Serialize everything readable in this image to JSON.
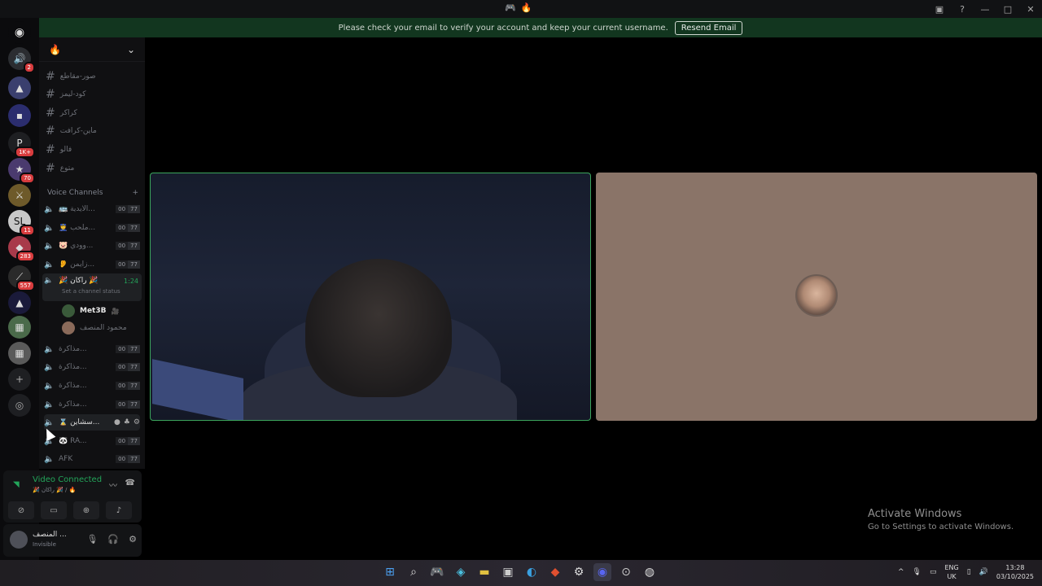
{
  "window": {
    "title_icons": [
      "game-icon",
      "fire-icon"
    ],
    "controls": [
      "inbox-icon",
      "help-icon",
      "minimize",
      "maximize",
      "close"
    ]
  },
  "banner": {
    "message": "Please check your email to verify your account and keep your current username.",
    "resend_label": "Resend Email"
  },
  "servers": [
    {
      "name": "dm",
      "badge": "2"
    },
    {
      "name": "server-a",
      "badge": ""
    },
    {
      "name": "folder",
      "badge": ""
    },
    {
      "name": "server-p",
      "badge": "1K+"
    },
    {
      "name": "server-70",
      "badge": "70"
    },
    {
      "name": "server-batman",
      "badge": ""
    },
    {
      "name": "server-sl",
      "badge": "11"
    },
    {
      "name": "server-283",
      "badge": "283"
    },
    {
      "name": "server-557",
      "badge": "557"
    },
    {
      "name": "server-a2",
      "badge": ""
    },
    {
      "name": "server-img1",
      "badge": ""
    },
    {
      "name": "server-img2",
      "badge": ""
    }
  ],
  "channels": {
    "server_name": "🔥",
    "text_channels": [
      "صور-مقاطع",
      "كود-ليمز",
      "كراكر",
      "ماين-كرافت",
      "فالو",
      "متوع"
    ],
    "voice_header": "Voice Channels",
    "voice_channels": [
      {
        "name": "🚌 الايدية...",
        "c1": "00",
        "c2": "77"
      },
      {
        "name": "👮 ملحب...",
        "c1": "00",
        "c2": "77"
      },
      {
        "name": "🐷 وودي...",
        "c1": "00",
        "c2": "77"
      },
      {
        "name": "👂 زايمن...",
        "c1": "00",
        "c2": "77"
      }
    ],
    "active_voice": {
      "name": "🎉 راكان 🎉",
      "time": "1:24",
      "status": "Set a channel status"
    },
    "members": [
      {
        "name": "Met3B",
        "color": "#e8e8e8"
      },
      {
        "name": "محمود المنصف",
        "color": "#6e7178"
      }
    ],
    "more_voice": [
      {
        "name": "مذاكرة...",
        "c1": "00",
        "c2": "77"
      },
      {
        "name": "مذاكرة...",
        "c1": "00",
        "c2": "77"
      },
      {
        "name": "مذاكرة...",
        "c1": "00",
        "c2": "77"
      },
      {
        "name": "مذاكرة...",
        "c1": "00",
        "c2": "77"
      },
      {
        "name": "⌛ سشاين...",
        "c1": "",
        "c2": ""
      },
      {
        "name": "🐼 RA...",
        "c1": "00",
        "c2": "77"
      },
      {
        "name": "AFK",
        "c1": "00",
        "c2": "77"
      }
    ]
  },
  "voice_panel": {
    "status": "Video Connected",
    "sub": "🎉 راكان 🎉 / 🔥",
    "buttons": [
      "camera-off-icon",
      "screen-share-icon",
      "activity-icon",
      "soundboard-icon"
    ]
  },
  "user": {
    "name": "المنصف ...",
    "status": "Invisible"
  },
  "activate": {
    "title": "Activate Windows",
    "subtitle": "Go to Settings to activate Windows."
  },
  "taskbar": {
    "lang": "ENG",
    "region": "UK",
    "time": "13:28",
    "date": "03/10/2025"
  }
}
